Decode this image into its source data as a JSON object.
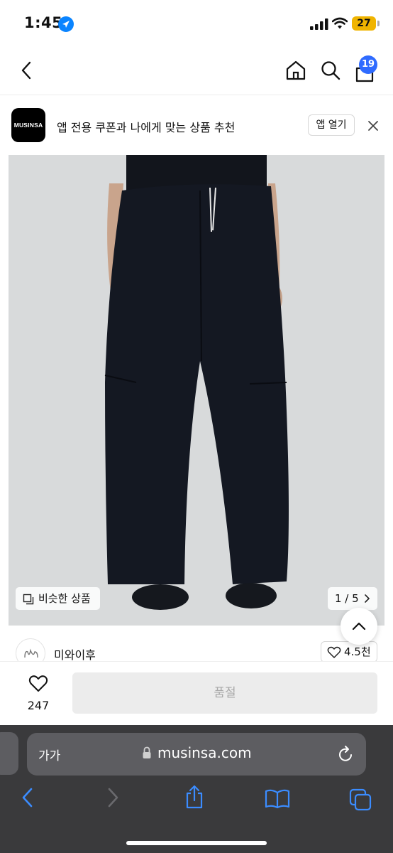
{
  "status_bar": {
    "time": "1:45",
    "battery": "27"
  },
  "banner": {
    "logo_text": "MUSINSA",
    "message": "앱 전용 쿠폰과 나에게 맞는 상품 추천",
    "open_button": "앱 열기"
  },
  "header": {
    "cart_count": "19"
  },
  "gallery": {
    "similar_label": "비슷한 상품",
    "counter": "1 / 5"
  },
  "brand": {
    "name": "미와이후",
    "likes": "4.5천"
  },
  "actions": {
    "like_count": "247",
    "soldout_label": "품절"
  },
  "browser": {
    "text_size_label": "가가",
    "url": "musinsa.com"
  },
  "colors": {
    "accent": "#0a84ff",
    "badge": "#2f6bff",
    "battery": "#f0b400",
    "safari_bg": "#3a3a3c"
  }
}
